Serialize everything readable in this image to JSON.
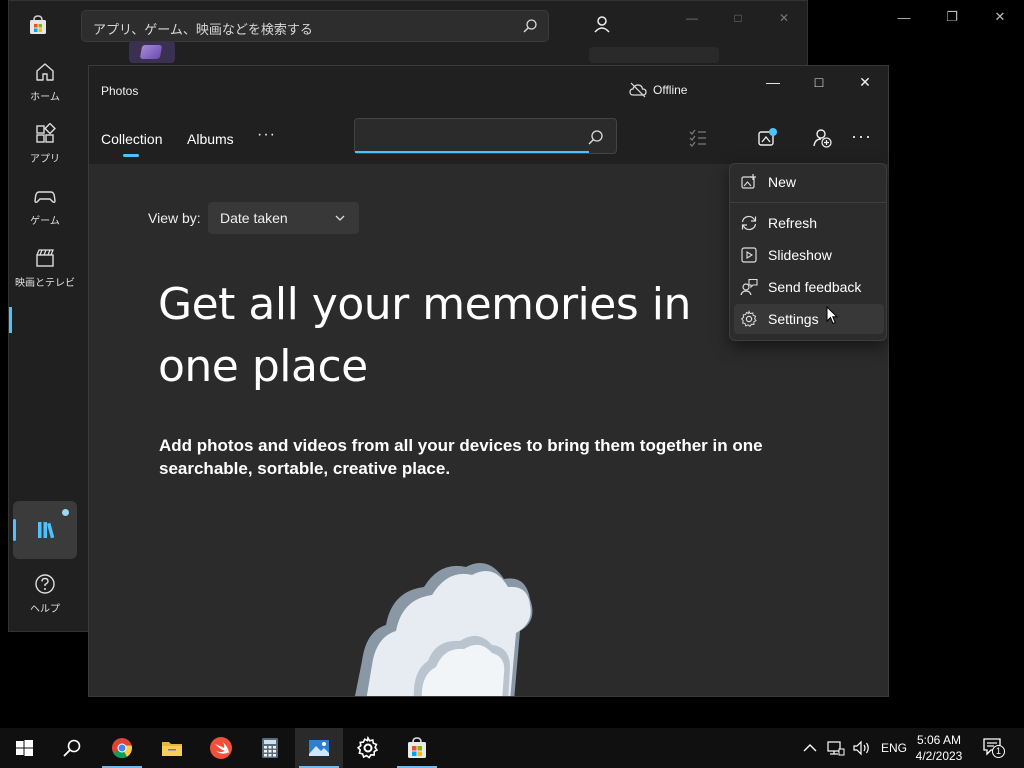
{
  "store": {
    "search_placeholder": "アプリ、ゲーム、映画などを検索する",
    "nav": [
      {
        "label": "ホーム",
        "icon": "home-icon"
      },
      {
        "label": "アプリ",
        "icon": "apps-icon"
      },
      {
        "label": "ゲーム",
        "icon": "gamepad-icon"
      },
      {
        "label": "映画とテレビ",
        "icon": "clapperboard-icon"
      }
    ],
    "library_icon": "library-icon",
    "help_label": "ヘルプ"
  },
  "photos": {
    "title": "Photos",
    "status": "Offline",
    "tabs": [
      {
        "label": "Collection"
      },
      {
        "label": "Albums"
      }
    ],
    "more_label": "···",
    "search_value": "",
    "view_by_label": "View by:",
    "view_by_value": "Date taken",
    "headline": "Get all your memories in one place",
    "subtext": "Add photos and videos from all your devices to bring them together in one searchable, sortable, creative place."
  },
  "menu": {
    "items": [
      {
        "label": "New",
        "icon": "new-image-icon"
      },
      {
        "label": "Refresh",
        "icon": "refresh-icon"
      },
      {
        "label": "Slideshow",
        "icon": "slideshow-icon"
      },
      {
        "label": "Send feedback",
        "icon": "feedback-icon"
      },
      {
        "label": "Settings",
        "icon": "gear-icon"
      }
    ]
  },
  "taskbar": {
    "apps": [
      "start",
      "search",
      "chrome",
      "file-explorer",
      "swift",
      "calculator",
      "photos",
      "settings",
      "store"
    ],
    "language": "ENG",
    "time": "5:06 AM",
    "date": "4/2/2023",
    "notifications": "1"
  },
  "colors": {
    "accent": "#4cc2ff",
    "window_bg": "#2b2b2b",
    "header_bg": "#202020"
  }
}
